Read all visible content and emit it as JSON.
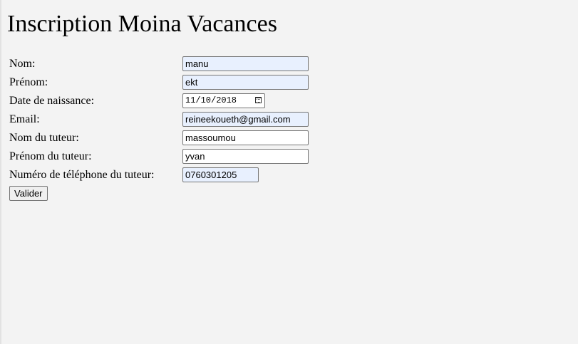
{
  "page": {
    "title": "Inscription Moina Vacances"
  },
  "form": {
    "nom_label": "Nom:",
    "nom_value": "manu",
    "prenom_label": "Prénom:",
    "prenom_value": "ekt",
    "dob_label": "Date de naissance:",
    "dob_value": "11/10/2018",
    "email_label": "Email:",
    "email_value": "reineekoueth@gmail.com",
    "tuteur_nom_label": "Nom du tuteur:",
    "tuteur_nom_value": "massoumou",
    "tuteur_prenom_label": "Prénom du tuteur:",
    "tuteur_prenom_value": "yvan",
    "tuteur_tel_label": "Numéro de téléphone du tuteur:",
    "tuteur_tel_value": "0760301205",
    "submit_label": "Valider"
  },
  "icons": {
    "date_picker": "calendar-icon"
  },
  "colors": {
    "background": "#f3f3f3",
    "autofill": "#e8f0fe",
    "border": "#767676"
  }
}
